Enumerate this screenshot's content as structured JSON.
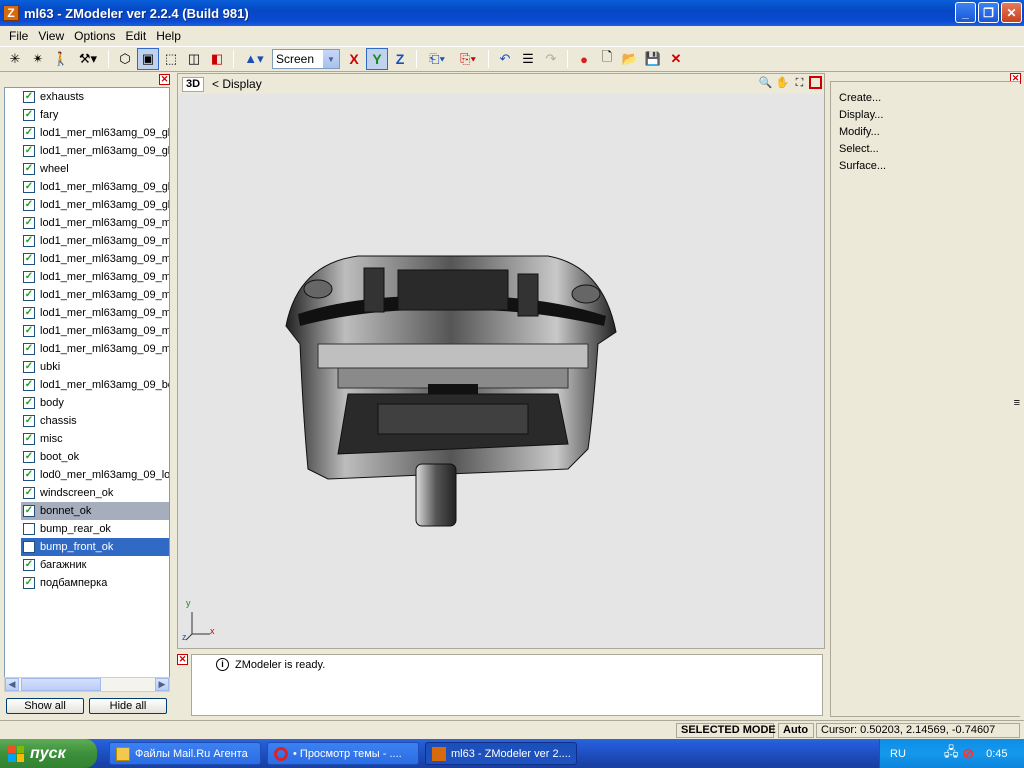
{
  "window": {
    "title": "ml63 - ZModeler ver 2.2.4 (Build 981)",
    "app_icon_letter": "Z"
  },
  "menu": [
    "File",
    "View",
    "Options",
    "Edit",
    "Help"
  ],
  "toolbar": {
    "coord_system": "Screen",
    "axis_x": "X",
    "axis_y": "Y",
    "axis_z": "Z"
  },
  "left_panel": {
    "objects": [
      {
        "label": "exhausts",
        "checked": true,
        "state": "normal"
      },
      {
        "label": "fary",
        "checked": true,
        "state": "normal"
      },
      {
        "label": "lod1_mer_ml63amg_09_gla",
        "checked": true,
        "state": "normal"
      },
      {
        "label": "lod1_mer_ml63amg_09_gla",
        "checked": true,
        "state": "normal"
      },
      {
        "label": "wheel",
        "checked": true,
        "state": "normal"
      },
      {
        "label": "lod1_mer_ml63amg_09_gla",
        "checked": true,
        "state": "normal"
      },
      {
        "label": "lod1_mer_ml63amg_09_gla",
        "checked": true,
        "state": "normal"
      },
      {
        "label": "lod1_mer_ml63amg_09_mir",
        "checked": true,
        "state": "normal"
      },
      {
        "label": "lod1_mer_ml63amg_09_mir",
        "checked": true,
        "state": "normal"
      },
      {
        "label": "lod1_mer_ml63amg_09_mir",
        "checked": true,
        "state": "normal"
      },
      {
        "label": "lod1_mer_ml63amg_09_mir",
        "checked": true,
        "state": "normal"
      },
      {
        "label": "lod1_mer_ml63amg_09_mir",
        "checked": true,
        "state": "normal"
      },
      {
        "label": "lod1_mer_ml63amg_09_mir",
        "checked": true,
        "state": "normal"
      },
      {
        "label": "lod1_mer_ml63amg_09_mir",
        "checked": true,
        "state": "normal"
      },
      {
        "label": "lod1_mer_ml63amg_09_mir",
        "checked": true,
        "state": "normal"
      },
      {
        "label": "ubki",
        "checked": true,
        "state": "normal"
      },
      {
        "label": "lod1_mer_ml63amg_09_boo",
        "checked": true,
        "state": "normal"
      },
      {
        "label": "body",
        "checked": true,
        "state": "normal"
      },
      {
        "label": "chassis",
        "checked": true,
        "state": "normal"
      },
      {
        "label": "misc",
        "checked": true,
        "state": "normal"
      },
      {
        "label": "boot_ok",
        "checked": true,
        "state": "normal"
      },
      {
        "label": "lod0_mer_ml63amg_09_lod",
        "checked": true,
        "state": "normal"
      },
      {
        "label": "windscreen_ok",
        "checked": true,
        "state": "normal"
      },
      {
        "label": "bonnet_ok",
        "checked": true,
        "state": "selected-gray"
      },
      {
        "label": "bump_rear_ok",
        "checked": false,
        "state": "normal"
      },
      {
        "label": "bump_front_ok",
        "checked": false,
        "state": "selected-blue"
      },
      {
        "label": "багажник",
        "checked": true,
        "state": "normal"
      },
      {
        "label": "подбамперка",
        "checked": true,
        "state": "normal"
      }
    ],
    "show_all_label": "Show all",
    "hide_all_label": "Hide all"
  },
  "viewport": {
    "mode_label": "3D",
    "display_label": "<  Display",
    "gizmo_y": "y",
    "gizmo_x": "x",
    "gizmo_z": "z"
  },
  "log": {
    "message": "ZModeler is ready."
  },
  "commands": [
    "Create...",
    "Display...",
    "Modify...",
    "Select...",
    "Surface..."
  ],
  "status": {
    "mode": "SELECTED MODE",
    "auto": "Auto",
    "cursor": "Cursor: 0.50203, 2.14569, -0.74607"
  },
  "taskbar": {
    "start_label": "пуск",
    "tasks": [
      {
        "label": "Файлы Mail.Ru Агента",
        "active": false
      },
      {
        "label": "• Просмотр темы - ....",
        "active": false
      },
      {
        "label": "ml63 - ZModeler ver 2....",
        "active": true
      }
    ],
    "lang": "RU",
    "clock": "0:45"
  },
  "colors": {
    "title_bar": "#0a5fd8",
    "selection_blue": "#316ac5",
    "selection_gray": "#a6aebd",
    "viewport_bg": "#e5e5e5",
    "start_green": "#3c8f3b"
  }
}
